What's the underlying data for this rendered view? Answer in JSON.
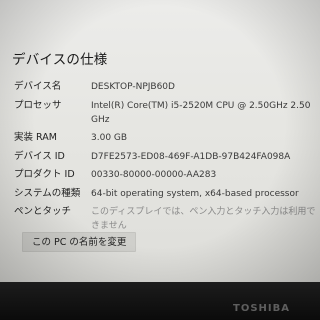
{
  "section_title": "デバイスの仕様",
  "specs": [
    {
      "label": "デバイス名",
      "value": "DESKTOP-NPJB60D"
    },
    {
      "label": "プロセッサ",
      "value": "Intel(R) Core(TM) i5-2520M CPU @ 2.50GHz   2.50 GHz"
    },
    {
      "label": "実装 RAM",
      "value": "3.00 GB"
    },
    {
      "label": "デバイス ID",
      "value": "D7FE2573-ED08-469F-A1DB-97B424FA098A"
    },
    {
      "label": "プロダクト ID",
      "value": "00330-80000-00000-AA283"
    },
    {
      "label": "システムの種類",
      "value": "64-bit operating system, x64-based processor"
    },
    {
      "label": "ペンとタッチ",
      "value": "このディスプレイでは、ペン入力とタッチ入力は利用できません"
    }
  ],
  "rename_button": "この PC の名前を変更",
  "bezel_brand": "TOSHIBA"
}
